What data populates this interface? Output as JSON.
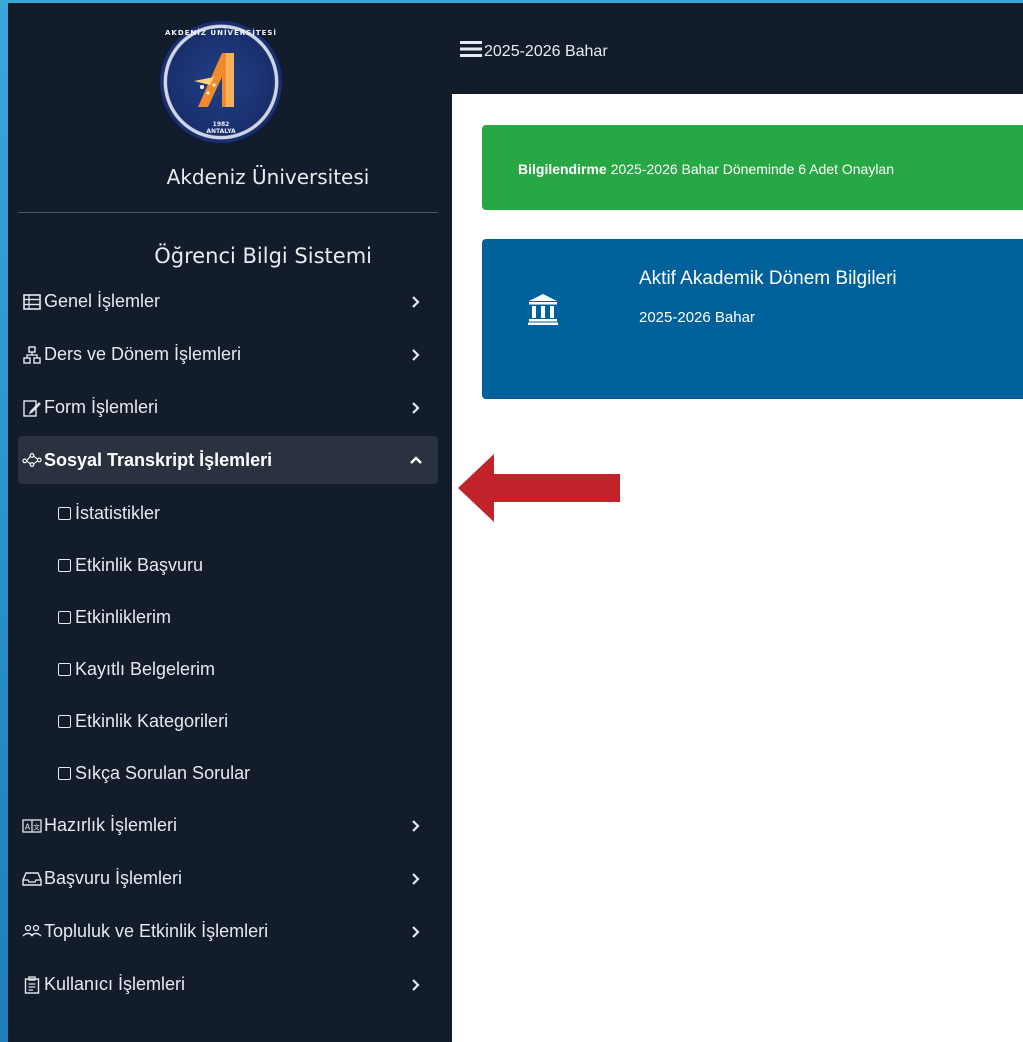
{
  "logo": {
    "ring_text": "AKDENİZ ÜNİVERSİTESİ",
    "year": "1982",
    "city": "ANTALYA"
  },
  "sidebar": {
    "university_name": "Akdeniz Üniversitesi",
    "system_title": "Öğrenci Bilgi Sistemi",
    "menu": [
      {
        "label": "Genel İşlemler",
        "icon": "grid-table-icon",
        "expanded": false
      },
      {
        "label": "Ders ve Dönem İşlemleri",
        "icon": "org-chart-icon",
        "expanded": false
      },
      {
        "label": "Form İşlemleri",
        "icon": "edit-form-icon",
        "expanded": false
      },
      {
        "label": "Sosyal Transkript İşlemleri",
        "icon": "network-icon",
        "expanded": true
      },
      {
        "label": "Hazırlık İşlemleri",
        "icon": "translate-icon",
        "expanded": false
      },
      {
        "label": "Başvuru İşlemleri",
        "icon": "inbox-icon",
        "expanded": false
      },
      {
        "label": "Topluluk ve Etkinlik İşlemleri",
        "icon": "people-icon",
        "expanded": false
      },
      {
        "label": "Kullanıcı İşlemleri",
        "icon": "clipboard-icon",
        "expanded": false
      }
    ],
    "submenu": [
      {
        "label": "İstatistikler"
      },
      {
        "label": "Etkinlik Başvuru"
      },
      {
        "label": "Etkinliklerim"
      },
      {
        "label": "Kayıtlı Belgelerim"
      },
      {
        "label": "Etkinlik Kategorileri"
      },
      {
        "label": "Sıkça Sorulan Sorular"
      }
    ]
  },
  "topbar": {
    "period": "2025-2026 Bahar"
  },
  "alert": {
    "title": "Bilgilendirme",
    "text": "2025-2026 Bahar Döneminde 6 Adet Onaylan"
  },
  "card": {
    "title": "Aktif Akademik Dönem Bilgileri",
    "subtitle": "2025-2026 Bahar",
    "icon": "bank-icon"
  },
  "colors": {
    "sidebar_bg": "#131c2b",
    "active_bg": "#2a3240",
    "alert_green": "#28a745",
    "card_blue": "#00609a",
    "arrow_red": "#c0232a"
  }
}
